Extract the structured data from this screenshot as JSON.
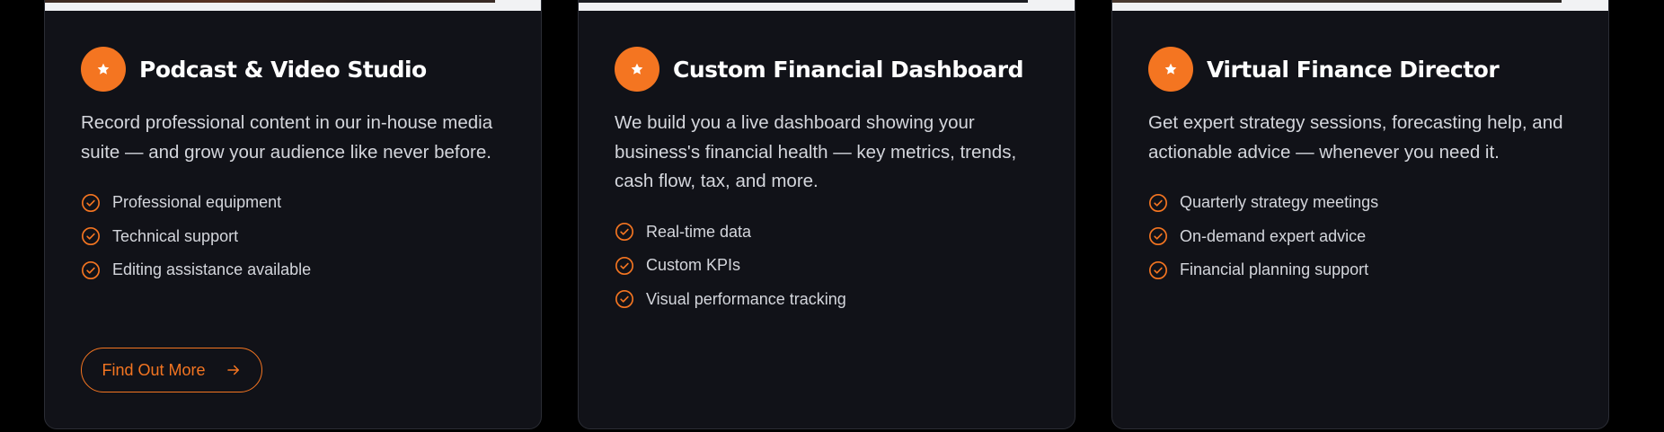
{
  "colors": {
    "accent": "#f47521",
    "card_bg": "#111218",
    "page_bg": "#000000",
    "text": "#d4d6dc",
    "title": "#ffffff"
  },
  "cards": [
    {
      "icon": "star-icon",
      "title": "Podcast & Video Studio",
      "description": "Record professional content in our in-house media suite — and grow your audience like never before.",
      "features": [
        "Professional equipment",
        "Technical support",
        "Editing assistance available"
      ],
      "cta_label": "Find Out More",
      "cta_icon": "arrow-right-icon"
    },
    {
      "icon": "star-icon",
      "title": "Custom Financial Dashboard",
      "description": "We build you a live dashboard showing your business's financial health — key metrics, trends, cash flow, tax, and more.",
      "features": [
        "Real-time data",
        "Custom KPIs",
        "Visual performance tracking"
      ]
    },
    {
      "icon": "star-icon",
      "title": "Virtual Finance Director",
      "description": "Get expert strategy sessions, forecasting help, and actionable advice — whenever you need it.",
      "features": [
        "Quarterly strategy meetings",
        "On-demand expert advice",
        "Financial planning support"
      ]
    }
  ]
}
